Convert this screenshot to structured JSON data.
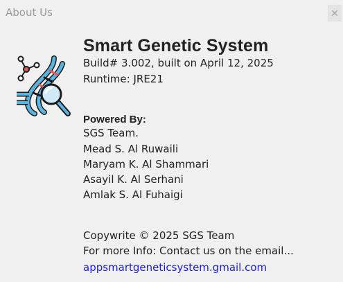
{
  "window": {
    "title": "About Us",
    "close_label": "✕"
  },
  "app": {
    "name": "Smart Genetic System",
    "build": "Build# 3.002, built on April 12, 2025",
    "runtime": "Runtime: JRE21",
    "logo_icon": "dna-magnifier-icon"
  },
  "credits": {
    "heading": "Powered By:",
    "members": [
      "SGS Team.",
      "Mead S. Al Ruwaili",
      "Maryam K. Al Shammari",
      "Asayil K. Al Serhani",
      "Amlak S. Al Fuhaigi"
    ]
  },
  "footer": {
    "copyright": "Copywrite © 2025 SGS Team",
    "more_info": "For more Info: Contact us on the email...",
    "email": "appsmartgeneticsystem.gmail.com"
  },
  "colors": {
    "dna_blue": "#5ab4e0",
    "dna_red": "#e05a5a",
    "link": "#1a1aee"
  }
}
